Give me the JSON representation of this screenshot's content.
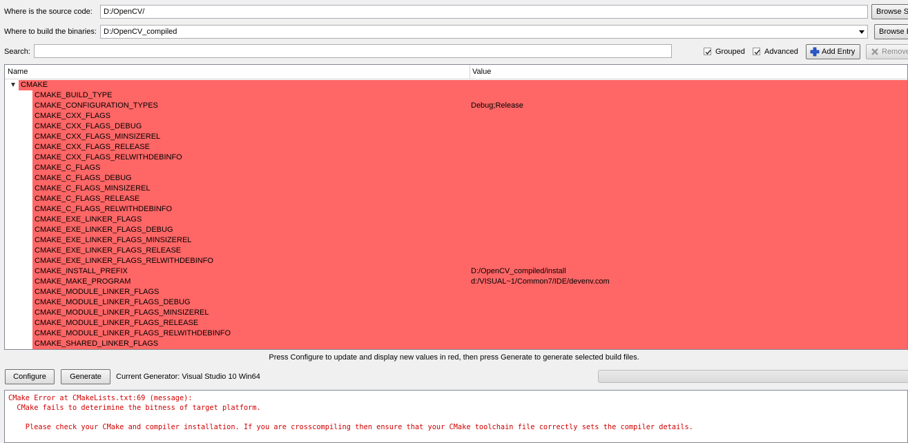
{
  "source": {
    "label": "Where is the source code:",
    "value": "D:/OpenCV/",
    "browse_label": "Browse Source..."
  },
  "build": {
    "label": "Where to build the binaries:",
    "value": "D:/OpenCV_compiled",
    "browse_label": "Browse Build..."
  },
  "search": {
    "label": "Search:",
    "value": ""
  },
  "options": {
    "grouped_label": "Grouped",
    "grouped_checked": true,
    "advanced_label": "Advanced",
    "advanced_checked": true,
    "add_entry_label": "Add Entry",
    "remove_entry_label": "Remove Entry"
  },
  "tree": {
    "columns": [
      "Name",
      "Value"
    ],
    "group": "CMAKE",
    "rows": [
      {
        "name": "CMAKE_BUILD_TYPE",
        "value": ""
      },
      {
        "name": "CMAKE_CONFIGURATION_TYPES",
        "value": "Debug;Release"
      },
      {
        "name": "CMAKE_CXX_FLAGS",
        "value": ""
      },
      {
        "name": "CMAKE_CXX_FLAGS_DEBUG",
        "value": ""
      },
      {
        "name": "CMAKE_CXX_FLAGS_MINSIZEREL",
        "value": ""
      },
      {
        "name": "CMAKE_CXX_FLAGS_RELEASE",
        "value": ""
      },
      {
        "name": "CMAKE_CXX_FLAGS_RELWITHDEBINFO",
        "value": ""
      },
      {
        "name": "CMAKE_C_FLAGS",
        "value": ""
      },
      {
        "name": "CMAKE_C_FLAGS_DEBUG",
        "value": ""
      },
      {
        "name": "CMAKE_C_FLAGS_MINSIZEREL",
        "value": ""
      },
      {
        "name": "CMAKE_C_FLAGS_RELEASE",
        "value": ""
      },
      {
        "name": "CMAKE_C_FLAGS_RELWITHDEBINFO",
        "value": ""
      },
      {
        "name": "CMAKE_EXE_LINKER_FLAGS",
        "value": ""
      },
      {
        "name": "CMAKE_EXE_LINKER_FLAGS_DEBUG",
        "value": ""
      },
      {
        "name": "CMAKE_EXE_LINKER_FLAGS_MINSIZEREL",
        "value": ""
      },
      {
        "name": "CMAKE_EXE_LINKER_FLAGS_RELEASE",
        "value": ""
      },
      {
        "name": "CMAKE_EXE_LINKER_FLAGS_RELWITHDEBINFO",
        "value": ""
      },
      {
        "name": "CMAKE_INSTALL_PREFIX",
        "value": "D:/OpenCV_compiled/install"
      },
      {
        "name": "CMAKE_MAKE_PROGRAM",
        "value": "d:/VISUAL~1/Common7/IDE/devenv.com"
      },
      {
        "name": "CMAKE_MODULE_LINKER_FLAGS",
        "value": ""
      },
      {
        "name": "CMAKE_MODULE_LINKER_FLAGS_DEBUG",
        "value": ""
      },
      {
        "name": "CMAKE_MODULE_LINKER_FLAGS_MINSIZEREL",
        "value": ""
      },
      {
        "name": "CMAKE_MODULE_LINKER_FLAGS_RELEASE",
        "value": ""
      },
      {
        "name": "CMAKE_MODULE_LINKER_FLAGS_RELWITHDEBINFO",
        "value": ""
      },
      {
        "name": "CMAKE_SHARED_LINKER_FLAGS",
        "value": ""
      }
    ]
  },
  "hint": "Press Configure to update and display new values in red, then press Generate to generate selected build files.",
  "actions": {
    "configure_label": "Configure",
    "generate_label": "Generate",
    "generator_text": "Current Generator: Visual Studio 10 Win64"
  },
  "output": {
    "lines": [
      "CMake Error at CMakeLists.txt:69 (message):",
      "  CMake fails to deterimine the bitness of target platform.",
      "",
      "    Please check your CMake and compiler installation. If you are crosscompiling then ensure that your CMake toolchain file correctly sets the compiler details."
    ]
  },
  "colors": {
    "new_value_bg": "#ff6666",
    "error_text": "#d00000"
  },
  "icons": {
    "add_entry": "plus-icon",
    "remove_entry": "cross-icon",
    "group_expander": "expander-down-icon"
  }
}
